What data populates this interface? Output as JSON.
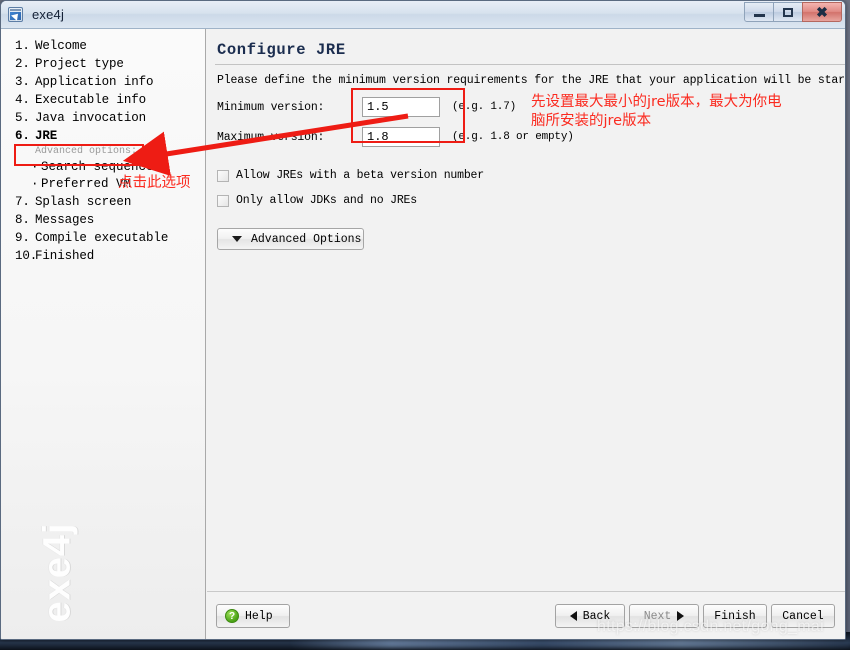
{
  "window": {
    "title": "exe4j",
    "app_icon": "exe4j-app-icon",
    "controls": {
      "minimize": "minimize-icon",
      "maximize": "maximize-icon",
      "close": "close-icon"
    }
  },
  "sidebar": {
    "watermark": "exe4j",
    "advanced_label": "Advanced options:",
    "steps": [
      {
        "num": "1.",
        "label": "Welcome"
      },
      {
        "num": "2.",
        "label": "Project type"
      },
      {
        "num": "3.",
        "label": "Application info"
      },
      {
        "num": "4.",
        "label": "Executable info"
      },
      {
        "num": "5.",
        "label": "Java invocation"
      },
      {
        "num": "6.",
        "label": "JRE"
      },
      {
        "num": "7.",
        "label": "Splash screen"
      },
      {
        "num": "8.",
        "label": "Messages"
      },
      {
        "num": "9.",
        "label": "Compile executable"
      },
      {
        "num": "10.",
        "label": "Finished"
      }
    ],
    "substeps": [
      {
        "label": "Search sequence"
      },
      {
        "label": "Preferred VM"
      }
    ]
  },
  "content": {
    "title": "Configure JRE",
    "intro": "Please define the minimum version requirements for the JRE that your application will be started with.",
    "fields": [
      {
        "label": "Minimum version:",
        "value": "1.5",
        "hint": "(e.g. 1.7)"
      },
      {
        "label": "Maximum version:",
        "value": "1.8",
        "hint": "(e.g. 1.8 or empty)"
      }
    ],
    "checkboxes": [
      {
        "label": "Allow JREs with a beta version number",
        "checked": false
      },
      {
        "label": "Only allow JDKs and no JREs",
        "checked": false
      }
    ],
    "advanced_button": "Advanced Options"
  },
  "footer": {
    "help": "Help",
    "back": "Back",
    "next": "Next",
    "finish": "Finish",
    "cancel": "Cancel"
  },
  "annotations": {
    "note_top": "先设置最大最小的jre版本，最大为你电",
    "note_top_2": "脑所安装的jre版本",
    "note_sidebar": "点击此选项",
    "box_color": "#ee1c14",
    "watermark_url": "https://blog.csdn.net/gong_mai"
  }
}
